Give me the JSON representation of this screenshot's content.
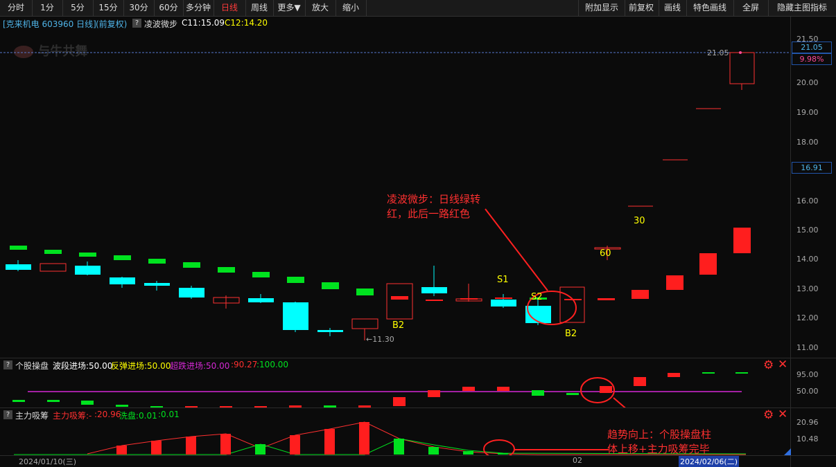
{
  "toolbar": {
    "left": [
      "分时",
      "1分",
      "5分",
      "15分",
      "30分",
      "60分",
      "多分钟",
      "日线",
      "周线",
      "更多▼",
      "放大",
      "缩小"
    ],
    "right": [
      "附加显示",
      "前复权",
      "画线",
      "特色画线",
      "全屏",
      "隐藏主图指标"
    ],
    "active": "日线"
  },
  "main": {
    "stock": "[克来机电 603960 日线]",
    "adjust": "(前复权)",
    "indicator": "凌波微步",
    "c1": "C11:15.09",
    "c2": "C12:14.20",
    "watermark": "与牛共舞",
    "price_ticks": [
      "21.50",
      "20.00",
      "19.00",
      "18.00",
      "16.00",
      "15.00",
      "14.00",
      "13.00",
      "12.00",
      "11.00"
    ],
    "current_price": "21.05",
    "current_pct": "9.98%",
    "cursor_price": "16.91",
    "high_label": "21.05",
    "low_label": "←11.30",
    "marks": {
      "s1": "S1",
      "s2": "S2",
      "b2a": "B2",
      "b2b": "B2",
      "n60": "60",
      "n30": "30"
    }
  },
  "panel1": {
    "name": "个股操盘",
    "legend": [
      "波段进场:50.00",
      "反弹进场:50.00",
      "超跌进场:50.00",
      ":90.27",
      ":100.00"
    ],
    "ticks": [
      "95.00",
      "50.00"
    ]
  },
  "panel2": {
    "name": "主力吸筹",
    "legend": [
      "主力吸筹:-",
      ":20.96",
      "洗盘:0.01",
      ":0.01"
    ],
    "ticks": [
      "20.96",
      "10.48"
    ]
  },
  "xaxis": {
    "start": "2024/01/10(三)",
    "mid": "02",
    "end": "2024/02/06(二)"
  },
  "annotations": {
    "a1_line1": "凌波微步：日线绿转",
    "a1_line2": "红，此后一路红色",
    "a2_line1": "趋势向上：个股操盘柱",
    "a2_line2": "体上移+主力吸筹完毕"
  },
  "colors": {
    "up": "#ff1e1e",
    "down": "#00ffff",
    "green": "#00e21f",
    "magenta": "#d428d4",
    "annot": "#ff3030"
  }
}
